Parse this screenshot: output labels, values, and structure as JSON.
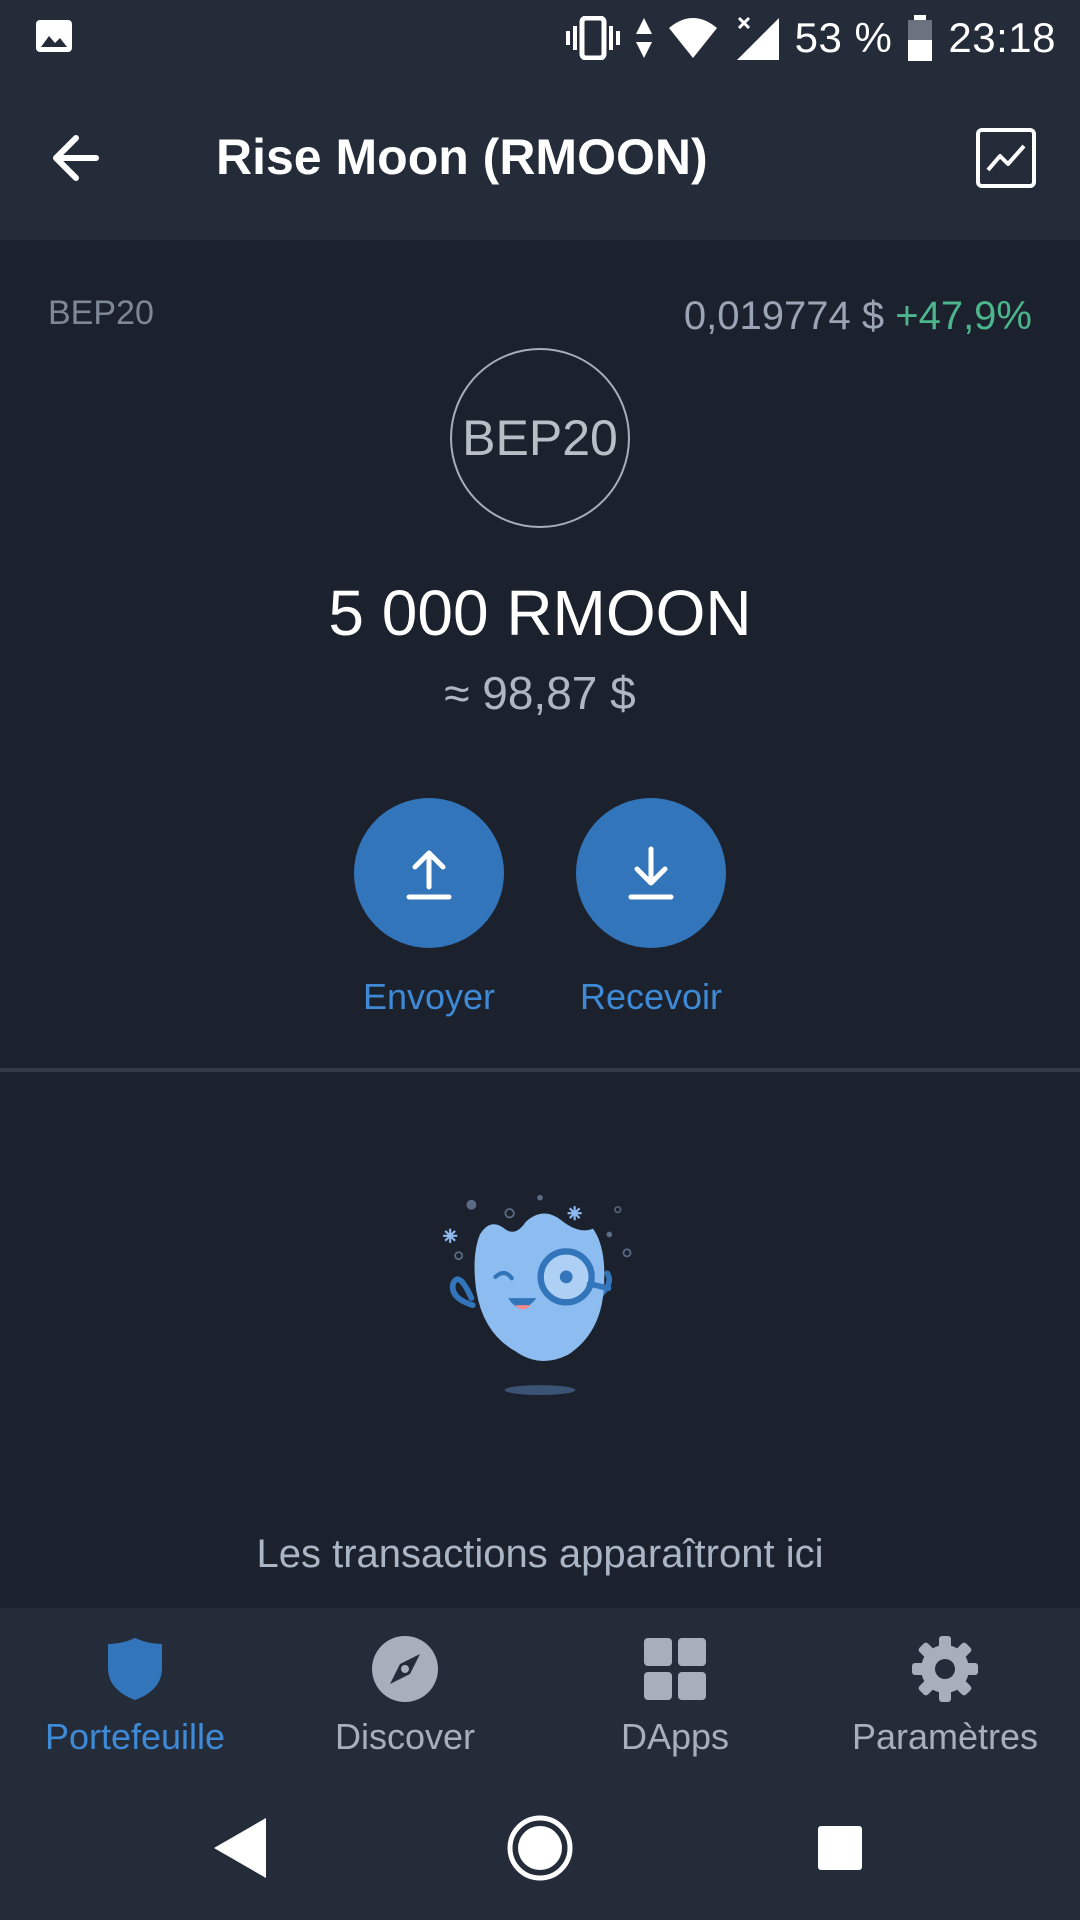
{
  "status_bar": {
    "battery_percent": "53 %",
    "time": "23:18",
    "icons": [
      "gallery-icon",
      "vibrate-icon",
      "data-arrows-icon",
      "wifi-icon",
      "signal-icon",
      "battery-icon"
    ]
  },
  "header": {
    "title": "Rise Moon (RMOON)",
    "back_icon": "arrow-left-icon",
    "chart_icon": "chart-icon"
  },
  "token": {
    "network": "BEP20",
    "price": "0,019774 $",
    "change": "+47,9%",
    "logo_text": "BEP20",
    "balance": "5 000 RMOON",
    "fiat_value": "≈ 98,87 $"
  },
  "actions": {
    "send_label": "Envoyer",
    "receive_label": "Recevoir"
  },
  "empty_state": {
    "message": "Les transactions apparaîtront ici"
  },
  "bottom_nav": {
    "items": [
      {
        "label": "Portefeuille",
        "icon": "shield-icon",
        "active": true
      },
      {
        "label": "Discover",
        "icon": "compass-icon",
        "active": false
      },
      {
        "label": "DApps",
        "icon": "grid-icon",
        "active": false
      },
      {
        "label": "Paramètres",
        "icon": "gear-icon",
        "active": false
      }
    ]
  },
  "colors": {
    "accent": "#3375bb",
    "positive": "#4cb58c",
    "background": "#1c222d",
    "bar": "#242c3a"
  }
}
